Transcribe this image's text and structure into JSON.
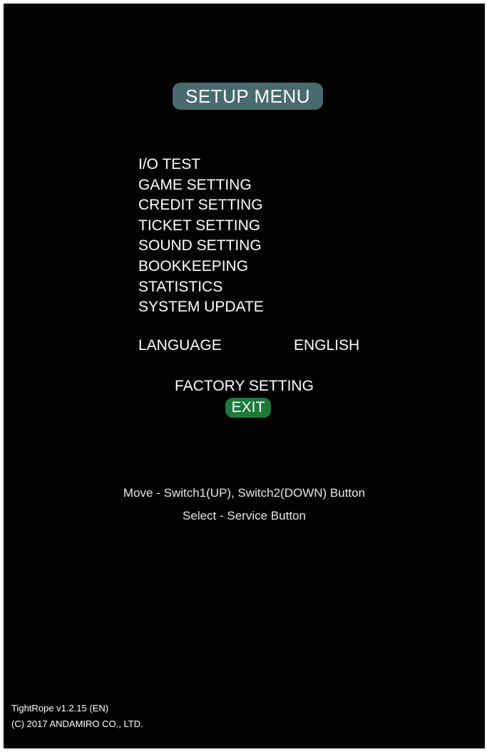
{
  "title": "SETUP MENU",
  "menu_items": [
    "I/O TEST",
    "GAME SETTING",
    "CREDIT SETTING",
    "TICKET SETTING",
    "SOUND SETTING",
    "BOOKKEEPING",
    "STATISTICS",
    "SYSTEM UPDATE"
  ],
  "language": {
    "label": "LANGUAGE",
    "value": "ENGLISH"
  },
  "factory_setting": "FACTORY SETTING",
  "exit": "EXIT",
  "help": {
    "move": "Move - Switch1(UP), Switch2(DOWN) Button",
    "select": "Select - Service Button"
  },
  "footer": {
    "version": "TightRope v1.2.15 (EN)",
    "copyright": "(C) 2017 ANDAMIRO CO., LTD."
  },
  "colors": {
    "background": "#020202",
    "title_pill": "#4a6b6e",
    "exit_highlight": "#1e7a3a",
    "text": "#ffffff"
  }
}
